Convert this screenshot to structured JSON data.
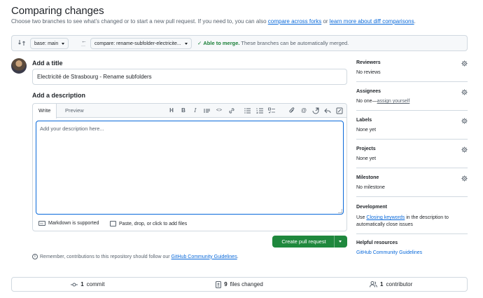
{
  "page": {
    "title": "Comparing changes",
    "subtitle_prefix": "Choose two branches to see what’s changed or to start a new pull request. If you need to, you can also ",
    "subtitle_link1": "compare across forks",
    "subtitle_mid": " or ",
    "subtitle_link2": "learn more about diff comparisons",
    "subtitle_suffix": "."
  },
  "compare_bar": {
    "base_label": "base: main",
    "compare_label": "compare: rename-subfolder-electricite...",
    "merge_ok": "Able to merge.",
    "merge_desc": " These branches can be automatically merged."
  },
  "form": {
    "title_heading": "Add a title",
    "title_value": "Electricité de Strasbourg - Rename subfolders",
    "desc_heading": "Add a description",
    "tab_write": "Write",
    "tab_preview": "Preview",
    "desc_placeholder": "Add your description here...",
    "markdown_note": "Markdown is supported",
    "attach_note": "Paste, drop, or click to add files",
    "create_button": "Create pull request",
    "remember_prefix": "Remember, contributions to this repository should follow our ",
    "remember_link": "GitHub Community Guidelines",
    "remember_suffix": "."
  },
  "sidebar": {
    "reviewers": {
      "title": "Reviewers",
      "value": "No reviews"
    },
    "assignees": {
      "title": "Assignees",
      "value_prefix": "No one—",
      "value_link": "assign yourself"
    },
    "labels": {
      "title": "Labels",
      "value": "None yet"
    },
    "projects": {
      "title": "Projects",
      "value": "None yet"
    },
    "milestone": {
      "title": "Milestone",
      "value": "No milestone"
    },
    "development": {
      "title": "Development",
      "text_prefix": "Use ",
      "text_link": "Closing keywords",
      "text_suffix": " in the description to",
      "text_line2": "automatically close issues"
    },
    "helpful": {
      "title": "Helpful resources",
      "link": "GitHub Community Guidelines"
    }
  },
  "stats": {
    "commits_count": "1",
    "commits_label": "commit",
    "files_count": "9",
    "files_label": "files changed",
    "contributors_count": "1",
    "contributors_label": "contributor"
  },
  "colors": {
    "accent": "#0969da",
    "success": "#1f883d",
    "merge_text": "#1a7f37"
  }
}
